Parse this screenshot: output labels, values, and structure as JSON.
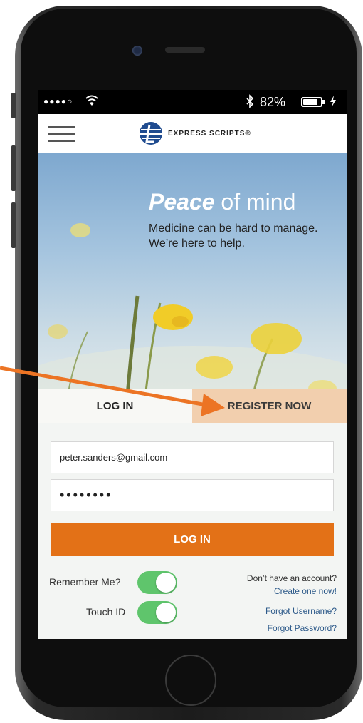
{
  "status_bar": {
    "signal": "●●●●○",
    "battery_percent": "82%",
    "battery_level": 0.82,
    "icons": [
      "wifi-icon",
      "bluetooth-icon",
      "battery-icon",
      "charging-icon"
    ]
  },
  "header": {
    "logo_text": "EXPRESS SCRIPTS®",
    "menu_icon": "hamburger-menu-icon"
  },
  "hero": {
    "title_bold": "Peace",
    "title_rest": " of mind",
    "subtitle": "Medicine can be hard to manage. We’re here to help."
  },
  "tabs": {
    "login": "LOG IN",
    "register": "REGISTER NOW"
  },
  "form": {
    "username_value": "peter.sanders@gmail.com",
    "password_value": "••••••••",
    "login_button": "LOG IN"
  },
  "options": {
    "remember_me_label": "Remember Me?",
    "remember_me_on": true,
    "touch_id_label": "Touch ID",
    "touch_id_on": true
  },
  "links": {
    "no_account": "Don’t have an account?",
    "create_account": "Create one now!",
    "forgot_username": "Forgot Username?",
    "forgot_password": "Forgot Password?"
  },
  "colors": {
    "accent_orange": "#e37117",
    "register_tab_bg": "#f2cfae",
    "toggle_green": "#5fc56c",
    "link_blue": "#2d5a8a"
  }
}
